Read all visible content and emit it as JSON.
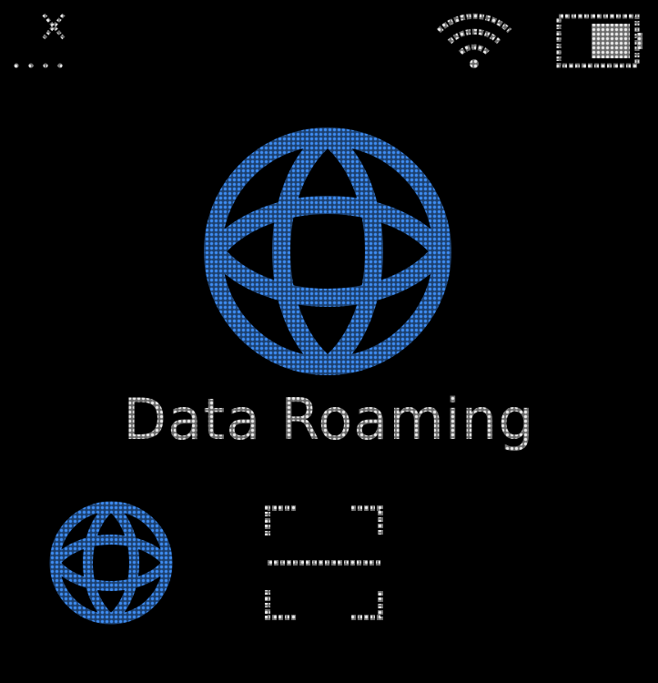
{
  "status_bar": {
    "signal": {
      "icon": "no-signal-icon",
      "state": "no service"
    },
    "wifi": {
      "icon": "wifi-icon",
      "strength": "full"
    },
    "battery": {
      "icon": "battery-icon",
      "level_fraction": 0.6
    }
  },
  "main": {
    "icon": "globe-icon",
    "title": "Data Roaming"
  },
  "menu": {
    "items": [
      {
        "icon": "globe-icon",
        "selected": true
      },
      {
        "icon": "scan-icon",
        "selected": false
      }
    ]
  },
  "colors": {
    "background": "#000000",
    "accent_blue": "#3d8bf0",
    "text_white": "#e8e8e8"
  }
}
